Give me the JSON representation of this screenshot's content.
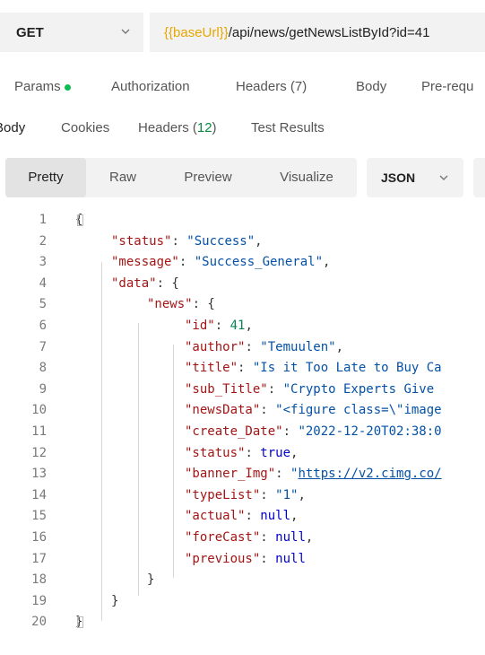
{
  "request": {
    "method": "GET",
    "url_variable": "{{baseUrl}}",
    "url_path": "/api/news/getNewsListById?id=41"
  },
  "request_tabs": [
    {
      "label": "Params"
    },
    {
      "label": "Authorization"
    },
    {
      "label": "Headers (7)"
    },
    {
      "label": "Body"
    },
    {
      "label": "Pre-requ"
    }
  ],
  "response_tabs": {
    "body": "Body",
    "cookies": "Cookies",
    "headers_label": "Headers (",
    "headers_count": "12",
    "headers_close": ")",
    "test_results": "Test Results"
  },
  "view_modes": [
    "Pretty",
    "Raw",
    "Preview",
    "Visualize"
  ],
  "format": "JSON",
  "lines": [
    {
      "n": "1",
      "tokens": [
        {
          "t": "{",
          "c": "p"
        }
      ]
    },
    {
      "n": "2",
      "tokens": [
        {
          "t": "\"status\"",
          "c": "k"
        },
        {
          "t": ": ",
          "c": "p"
        },
        {
          "t": "\"Success\"",
          "c": "s"
        },
        {
          "t": ",",
          "c": "p"
        }
      ]
    },
    {
      "n": "3",
      "tokens": [
        {
          "t": "\"message\"",
          "c": "k"
        },
        {
          "t": ": ",
          "c": "p"
        },
        {
          "t": "\"Success_General\"",
          "c": "s"
        },
        {
          "t": ",",
          "c": "p"
        }
      ]
    },
    {
      "n": "4",
      "tokens": [
        {
          "t": "\"data\"",
          "c": "k"
        },
        {
          "t": ": {",
          "c": "p"
        }
      ]
    },
    {
      "n": "5",
      "tokens": [
        {
          "t": "\"news\"",
          "c": "k"
        },
        {
          "t": ": {",
          "c": "p"
        }
      ]
    },
    {
      "n": "6",
      "tokens": [
        {
          "t": "\"id\"",
          "c": "k"
        },
        {
          "t": ": ",
          "c": "p"
        },
        {
          "t": "41",
          "c": "n"
        },
        {
          "t": ",",
          "c": "p"
        }
      ]
    },
    {
      "n": "7",
      "tokens": [
        {
          "t": "\"author\"",
          "c": "k"
        },
        {
          "t": ": ",
          "c": "p"
        },
        {
          "t": "\"Temuulen\"",
          "c": "s"
        },
        {
          "t": ",",
          "c": "p"
        }
      ]
    },
    {
      "n": "8",
      "tokens": [
        {
          "t": "\"title\"",
          "c": "k"
        },
        {
          "t": ": ",
          "c": "p"
        },
        {
          "t": "\"Is it Too Late to Buy Ca",
          "c": "s"
        }
      ]
    },
    {
      "n": "9",
      "tokens": [
        {
          "t": "\"sub_Title\"",
          "c": "k"
        },
        {
          "t": ": ",
          "c": "p"
        },
        {
          "t": "\"Crypto Experts Give",
          "c": "s"
        }
      ]
    },
    {
      "n": "10",
      "tokens": [
        {
          "t": "\"newsData\"",
          "c": "k"
        },
        {
          "t": ": ",
          "c": "p"
        },
        {
          "t": "\"<figure class=\\\"image",
          "c": "s"
        }
      ]
    },
    {
      "n": "11",
      "tokens": [
        {
          "t": "\"create_Date\"",
          "c": "k"
        },
        {
          "t": ": ",
          "c": "p"
        },
        {
          "t": "\"2022-12-20T02:38:0",
          "c": "s"
        }
      ]
    },
    {
      "n": "12",
      "tokens": [
        {
          "t": "\"status\"",
          "c": "k"
        },
        {
          "t": ": ",
          "c": "p"
        },
        {
          "t": "true",
          "c": "b"
        },
        {
          "t": ",",
          "c": "p"
        }
      ]
    },
    {
      "n": "13",
      "tokens": [
        {
          "t": "\"banner_Img\"",
          "c": "k"
        },
        {
          "t": ": ",
          "c": "p"
        },
        {
          "t": "\"",
          "c": "s"
        },
        {
          "t": "https://v2.cimg.co/",
          "c": "lnk"
        }
      ]
    },
    {
      "n": "14",
      "tokens": [
        {
          "t": "\"typeList\"",
          "c": "k"
        },
        {
          "t": ": ",
          "c": "p"
        },
        {
          "t": "\"1\"",
          "c": "s"
        },
        {
          "t": ",",
          "c": "p"
        }
      ]
    },
    {
      "n": "15",
      "tokens": [
        {
          "t": "\"actual\"",
          "c": "k"
        },
        {
          "t": ": ",
          "c": "p"
        },
        {
          "t": "null",
          "c": "b"
        },
        {
          "t": ",",
          "c": "p"
        }
      ]
    },
    {
      "n": "16",
      "tokens": [
        {
          "t": "\"foreCast\"",
          "c": "k"
        },
        {
          "t": ": ",
          "c": "p"
        },
        {
          "t": "null",
          "c": "b"
        },
        {
          "t": ",",
          "c": "p"
        }
      ]
    },
    {
      "n": "17",
      "tokens": [
        {
          "t": "\"previous\"",
          "c": "k"
        },
        {
          "t": ": ",
          "c": "p"
        },
        {
          "t": "null",
          "c": "b"
        }
      ]
    },
    {
      "n": "18",
      "tokens": [
        {
          "t": "}",
          "c": "p"
        }
      ]
    },
    {
      "n": "19",
      "tokens": [
        {
          "t": "}",
          "c": "p"
        }
      ]
    },
    {
      "n": "20",
      "tokens": [
        {
          "t": "}",
          "c": "p"
        }
      ]
    }
  ],
  "colors": {
    "url_variable": "#e6a700",
    "param_dot": "#0cbb52",
    "json_key": "#a31515",
    "json_string": "#0451a5",
    "json_number": "#098658",
    "json_keyword": "#0000cd"
  }
}
